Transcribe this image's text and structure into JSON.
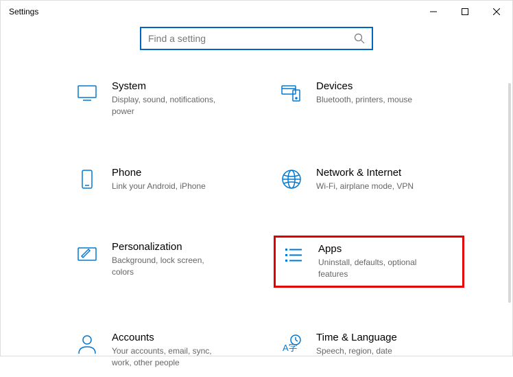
{
  "window": {
    "title": "Settings"
  },
  "search": {
    "placeholder": "Find a setting"
  },
  "categories": [
    {
      "id": "system",
      "label": "System",
      "desc": "Display, sound, notifications, power"
    },
    {
      "id": "devices",
      "label": "Devices",
      "desc": "Bluetooth, printers, mouse"
    },
    {
      "id": "phone",
      "label": "Phone",
      "desc": "Link your Android, iPhone"
    },
    {
      "id": "network",
      "label": "Network & Internet",
      "desc": "Wi-Fi, airplane mode, VPN"
    },
    {
      "id": "personalization",
      "label": "Personalization",
      "desc": "Background, lock screen, colors"
    },
    {
      "id": "apps",
      "label": "Apps",
      "desc": "Uninstall, defaults, optional features"
    },
    {
      "id": "accounts",
      "label": "Accounts",
      "desc": "Your accounts, email, sync, work, other people"
    },
    {
      "id": "time",
      "label": "Time & Language",
      "desc": "Speech, region, date"
    }
  ],
  "highlighted": "apps",
  "colors": {
    "accent": "#0078d4",
    "highlight_border": "#e30000"
  }
}
